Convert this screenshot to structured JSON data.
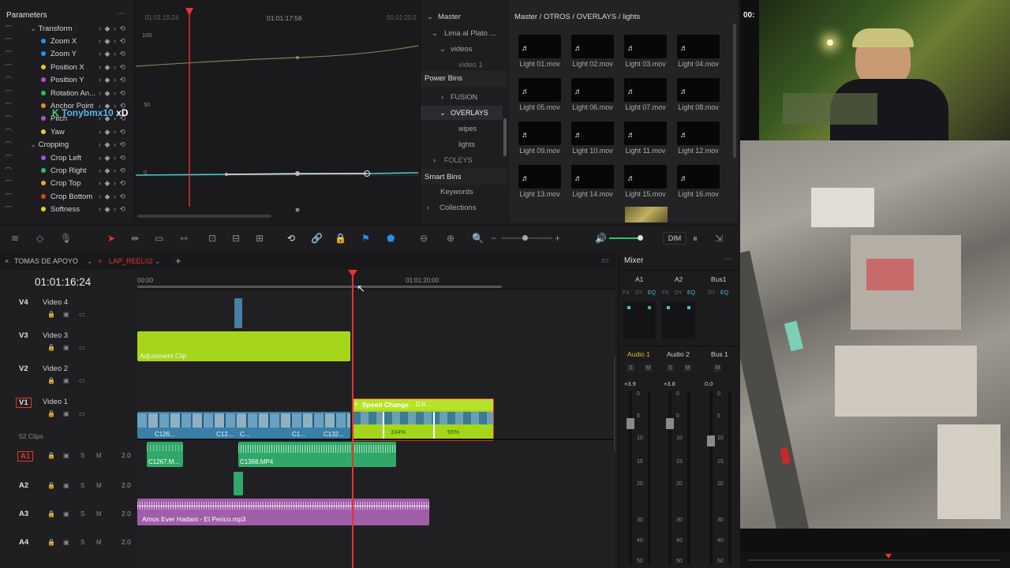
{
  "parameters": {
    "title": "Parameters",
    "rows": [
      {
        "label": "Transform",
        "color": "",
        "group": true
      },
      {
        "label": "Zoom X",
        "color": "#2f8cf0"
      },
      {
        "label": "Zoom Y",
        "color": "#2f8cf0"
      },
      {
        "label": "Position X",
        "color": "#e8c52a"
      },
      {
        "label": "Position Y",
        "color": "#b04ccf"
      },
      {
        "label": "Rotation An...",
        "color": "#2fbf5a"
      },
      {
        "label": "Anchor Point",
        "color": "#e08a2a"
      },
      {
        "label": "Pitch",
        "color": "#b04ccf"
      },
      {
        "label": "Yaw",
        "color": "#e8d22a"
      },
      {
        "label": "Cropping",
        "color": "",
        "group": true
      },
      {
        "label": "Crop Left",
        "color": "#9a5ad8"
      },
      {
        "label": "Crop Right",
        "color": "#2fbf6a"
      },
      {
        "label": "Crop Top",
        "color": "#e8a82a"
      },
      {
        "label": "Crop Bottom",
        "color": "#d8442a"
      },
      {
        "label": "Softness",
        "color": "#e8d22a"
      }
    ],
    "overlay_text": "Tonybmx10",
    "overlay_suffix": "xD"
  },
  "curve": {
    "time_labels": [
      "01:01:15:24",
      "01:01:17:56",
      "01:01:20:2"
    ],
    "y_labels": [
      "100",
      "50",
      "0"
    ]
  },
  "bins": {
    "master": "Master",
    "tree": [
      "Lima al Plato ...",
      "videos",
      "video 1"
    ],
    "power_bins_title": "Power Bins",
    "power_bins": [
      "FUSION",
      "OVERLAYS",
      "wipes",
      "lights",
      "FOLEYS"
    ],
    "smart_bins_title": "Smart Bins",
    "smart_bins": [
      "Keywords",
      "Collections"
    ]
  },
  "pool": {
    "path": "Master / OTROS / OVERLAYS / lights",
    "clips": [
      "Light 01.mov",
      "Light 02.mov",
      "Light 03.mov",
      "Light 04.mov",
      "Light 05.mov",
      "Light 06.mov",
      "Light 07.mov",
      "Light 08.mov",
      "Light 09.mov",
      "Light 10.mov",
      "Light 11.mov",
      "Light 12.mov",
      "Light 13.mov",
      "Light 14.mov",
      "Light 15.mov",
      "Light 16.mov"
    ]
  },
  "viewer": {
    "timecode_partial": "00:"
  },
  "toolbar": {
    "dim_label": "DIM"
  },
  "timeline": {
    "tabs": [
      "TOMAS DE APOYO",
      "LAP_REEL02"
    ],
    "timecode": "01:01:16:24",
    "ruler": [
      "00:00",
      "01:01:20:00"
    ],
    "clip_count": "52 Clips",
    "video_tracks": [
      {
        "id": "V4",
        "name": "Video 4"
      },
      {
        "id": "V3",
        "name": "Video 3"
      },
      {
        "id": "V2",
        "name": "Video 2"
      },
      {
        "id": "V1",
        "name": "Video 1"
      }
    ],
    "audio_tracks": [
      {
        "id": "A1",
        "level": "2.0"
      },
      {
        "id": "A2",
        "level": "2.0"
      },
      {
        "id": "A3",
        "level": "2.0"
      },
      {
        "id": "A4",
        "level": "2.0"
      }
    ],
    "adjustment_label": "Adjustment Clip",
    "speed_label": "Speed Change",
    "speed_clip": "DJI...",
    "speed_pct_1": "334%",
    "speed_pct_2": "55%",
    "v1_clip_labels": [
      "C126...",
      "C12...",
      "C...",
      "C1...",
      "C132..."
    ],
    "a1_clips": [
      "C1267.M...",
      "C1368.MP4"
    ],
    "a3_clip": "Amos Ever Hadani - El Perico.mp3"
  },
  "mixer": {
    "title": "Mixer",
    "channels": [
      "A1",
      "A2",
      "Bus1"
    ],
    "fx_labels": [
      "FX",
      "DY",
      "EQ",
      "FX",
      "DY",
      "EQ",
      "DY",
      "EQ"
    ],
    "strip_names": [
      "Audio 1",
      "Audio 2",
      "Bus 1"
    ],
    "levels": [
      "+3.9",
      "+3.8",
      "0.0"
    ],
    "scale": [
      "0",
      "5",
      "10",
      "15",
      "20",
      "30",
      "40",
      "50"
    ]
  },
  "colors": {
    "accent": "#e8332a",
    "clip_green": "#a5d61a",
    "audio_green": "#2fa868",
    "music_purple": "#a15ea9",
    "v1_clips": "#3a7fa8"
  }
}
